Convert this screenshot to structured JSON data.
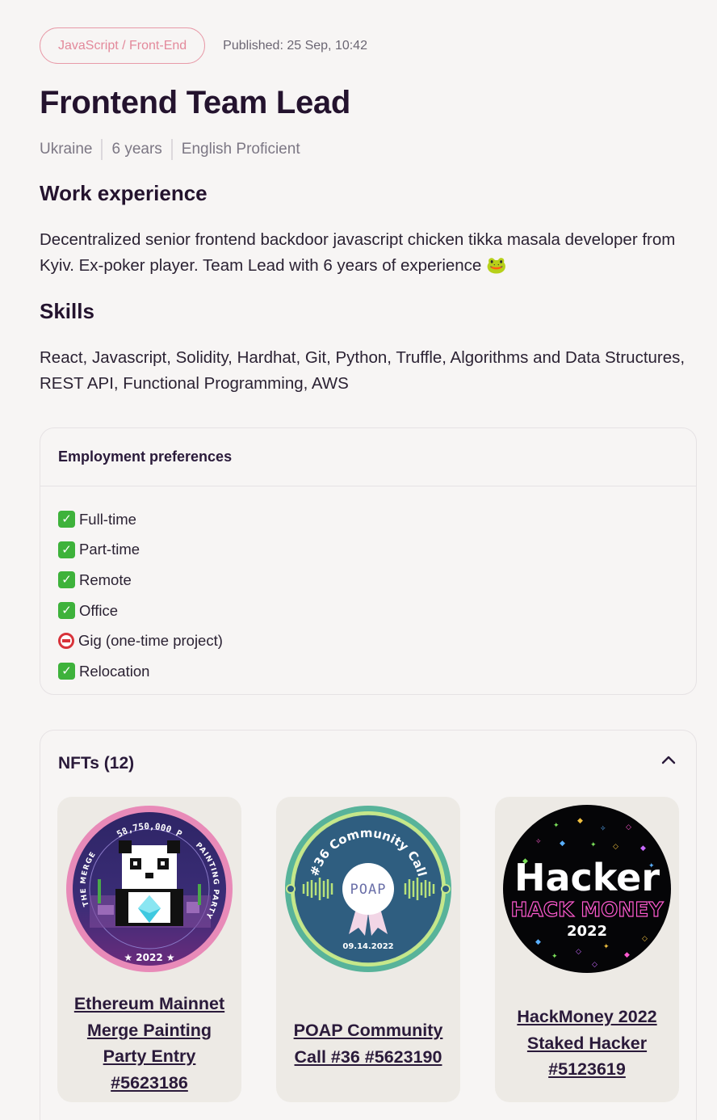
{
  "header": {
    "category": "JavaScript / Front-End",
    "published": "Published: 25 Sep, 10:42"
  },
  "title": "Frontend Team Lead",
  "meta": [
    "Ukraine",
    "6 years",
    "English Proficient"
  ],
  "work": {
    "title": "Work experience",
    "text": "Decentralized senior frontend backdoor javascript chicken tikka masala developer from Kyiv. Ex-poker player. Team Lead with 6 years of experience 🐸"
  },
  "skills": {
    "title": "Skills",
    "text": "React, Javascript, Solidity, Hardhat, Git, Python, Truffle, Algorithms and Data Structures, REST API, Functional Programming, AWS"
  },
  "employment": {
    "title": "Employment preferences",
    "items": [
      {
        "label": "Full-time",
        "status": "yes",
        "icon": "check-icon"
      },
      {
        "label": "Part-time",
        "status": "yes",
        "icon": "check-icon"
      },
      {
        "label": "Remote",
        "status": "yes",
        "icon": "check-icon"
      },
      {
        "label": "Office",
        "status": "yes",
        "icon": "check-icon"
      },
      {
        "label": "Gig (one-time project)",
        "status": "no",
        "icon": "no-entry-icon"
      },
      {
        "label": "Relocation",
        "status": "yes",
        "icon": "check-icon"
      }
    ]
  },
  "nfts": {
    "title": "NFTs (12)",
    "items": [
      {
        "name": "Ethereum Mainnet Merge Painting Party Entry #5623186",
        "badge_texts": [
          "58,750,000 P",
          "THE MERGE",
          "PAINTING PARTY",
          "★ 2022 ★"
        ]
      },
      {
        "name": "POAP Community Call #36 #5623190",
        "badge_texts": [
          "#36 Community Call",
          "POAP",
          "09.14.2022"
        ]
      },
      {
        "name": "HackMoney 2022 Staked Hacker #5123619",
        "badge_texts": [
          "Hacker",
          "HACK MONEY",
          "2022"
        ]
      }
    ]
  },
  "colors": {
    "accent_pink": "#e3899b",
    "text_dark": "#24132e",
    "check_green": "#3eb23b",
    "no_red": "#d8333a"
  }
}
